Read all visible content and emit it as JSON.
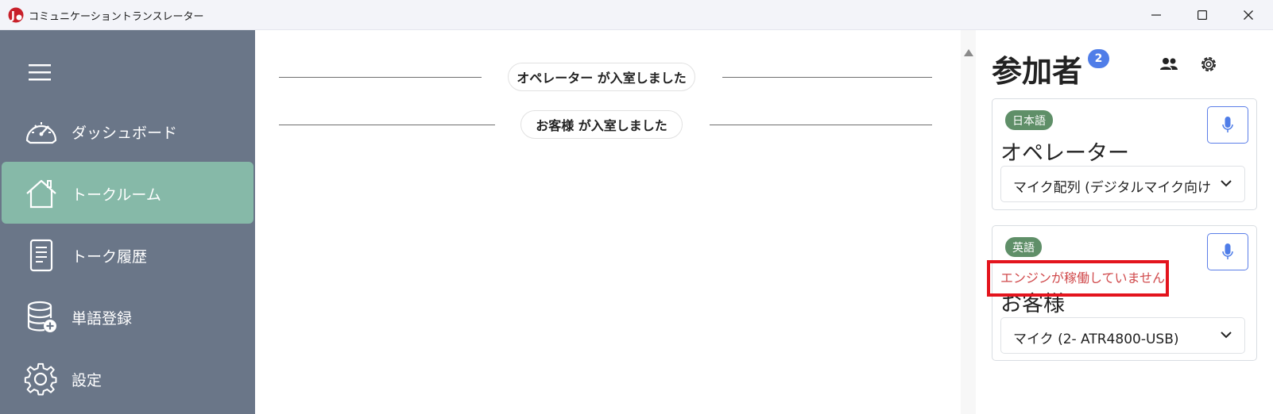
{
  "window": {
    "title": "コミュニケーショントランスレーター"
  },
  "sidebar": {
    "items": [
      {
        "label": "ダッシュボード",
        "icon": "dashboard-icon"
      },
      {
        "label": "トークルーム",
        "icon": "home-icon",
        "active": true
      },
      {
        "label": "トーク履歴",
        "icon": "document-icon"
      },
      {
        "label": "単語登録",
        "icon": "database-add-icon"
      },
      {
        "label": "設定",
        "icon": "gear-icon"
      }
    ]
  },
  "chat": {
    "messages": [
      {
        "text": "オペレーター が入室しました"
      },
      {
        "text": "お客様 が入室しました"
      }
    ]
  },
  "participants": {
    "title": "参加者",
    "count": "2",
    "cards": [
      {
        "language": "日本語",
        "name": "オペレーター",
        "device": "マイク配列 (デジタルマイク向けイ",
        "error": ""
      },
      {
        "language": "英語",
        "name": "お客様",
        "device": "マイク (2- ATR4800-USB)",
        "error": "エンジンが稼働していません"
      }
    ]
  },
  "colors": {
    "sidebar": "#6a7688",
    "active": "#86b9a8",
    "badge": "#4f7de8",
    "lang_badge": "#5f8f68",
    "error": "#d0494b",
    "highlight": "#e3141d"
  }
}
